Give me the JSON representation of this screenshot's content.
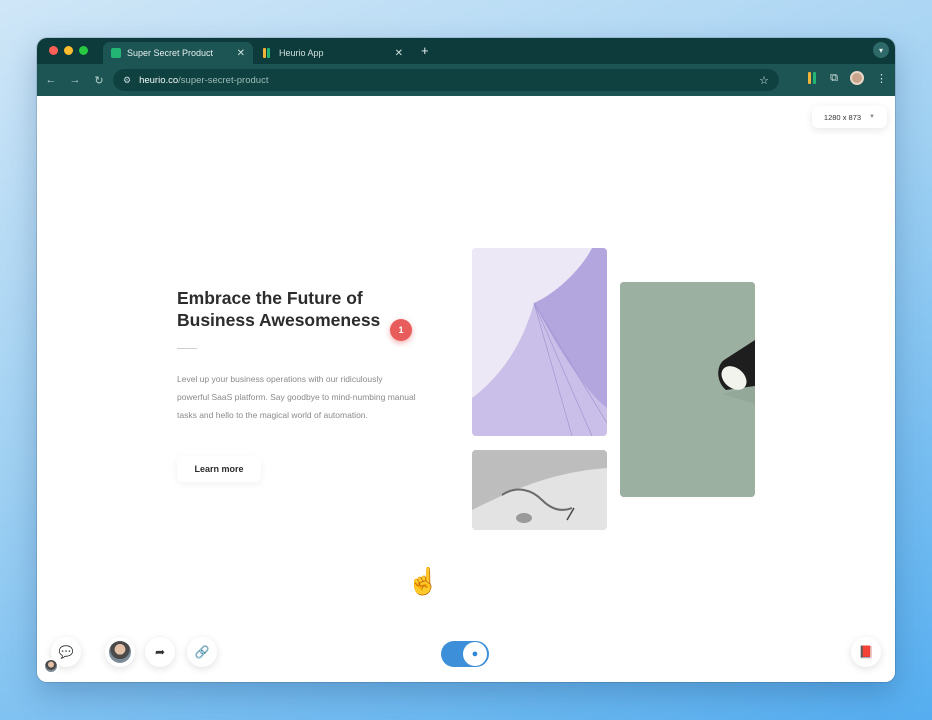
{
  "browser": {
    "tabs": [
      {
        "title": "Super Secret Product",
        "active": true,
        "favicon_color": "#22b573"
      },
      {
        "title": "Heurio App",
        "active": false,
        "favicon_color": "#f0b43a"
      }
    ],
    "close_glyph": "✕",
    "new_tab_glyph": "+",
    "url_host": "heurio.co",
    "url_path": "/super-secret-product",
    "traffic_lights": [
      "#ff5f57",
      "#febc2e",
      "#28c840"
    ],
    "theme_color": "#0d3a3a"
  },
  "page": {
    "viewport_label": "1280 x 873",
    "hero": {
      "title_line1": "Embrace the Future of",
      "title_line2": "Business Awesomeness",
      "body": "Level up your business operations with our ridiculously powerful SaaS platform. Say goodbye to mind-numbing manual tasks and hello to the magical world of automation.",
      "cta_label": "Learn more"
    },
    "comment_pin": "1"
  },
  "icons": {
    "back": "arrow-left-icon",
    "forward": "arrow-right-icon",
    "reload": "reload-icon",
    "site_settings": "tune-icon",
    "bookmark": "star-icon",
    "extension": "heurio-extension-icon",
    "extensions_menu": "puzzle-icon",
    "menu": "kebab-icon",
    "comments": "comments-icon",
    "share": "share-icon",
    "link": "link-icon",
    "guide": "book-icon",
    "pointer": "hand-cursor-icon"
  },
  "colors": {
    "pin": "#e85c5c",
    "toggle": "#3d8fd9",
    "accent_green": "#1d5454"
  }
}
